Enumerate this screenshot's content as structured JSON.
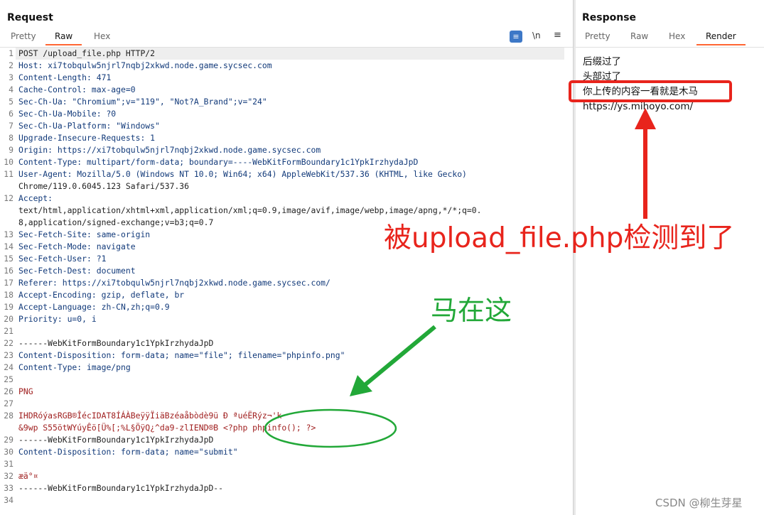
{
  "request": {
    "title": "Request",
    "tabs": [
      "Pretty",
      "Raw",
      "Hex"
    ],
    "active_tab": "Raw",
    "toolbar": {
      "wrap_icon": "≡",
      "newline_label": "\\n",
      "menu_icon": "≡"
    },
    "lines": [
      {
        "n": "1",
        "text": "POST /upload_file.php HTTP/2"
      },
      {
        "n": "2",
        "text": "Host: xi7tobqulw5njrl7nqbj2xkwd.node.game.sycsec.com"
      },
      {
        "n": "3",
        "text": "Content-Length: 471"
      },
      {
        "n": "4",
        "text": "Cache-Control: max-age=0"
      },
      {
        "n": "5",
        "text": "Sec-Ch-Ua: \"Chromium\";v=\"119\", \"Not?A_Brand\";v=\"24\""
      },
      {
        "n": "6",
        "text": "Sec-Ch-Ua-Mobile: ?0"
      },
      {
        "n": "7",
        "text": "Sec-Ch-Ua-Platform: \"Windows\""
      },
      {
        "n": "8",
        "text": "Upgrade-Insecure-Requests: 1"
      },
      {
        "n": "9",
        "text": "Origin: https://xi7tobqulw5njrl7nqbj2xkwd.node.game.sycsec.com"
      },
      {
        "n": "10",
        "text": "Content-Type: multipart/form-data; boundary=----WebKitFormBoundary1c1YpkIrzhydaJpD"
      },
      {
        "n": "11",
        "text": "User-Agent: Mozilla/5.0 (Windows NT 10.0; Win64; x64) AppleWebKit/537.36 (KHTML, like Gecko)"
      },
      {
        "n": "",
        "text": "Chrome/119.0.6045.123 Safari/537.36"
      },
      {
        "n": "12",
        "text": "Accept:"
      },
      {
        "n": "",
        "text": "text/html,application/xhtml+xml,application/xml;q=0.9,image/avif,image/webp,image/apng,*/*;q=0."
      },
      {
        "n": "",
        "text": "8,application/signed-exchange;v=b3;q=0.7"
      },
      {
        "n": "13",
        "text": "Sec-Fetch-Site: same-origin"
      },
      {
        "n": "14",
        "text": "Sec-Fetch-Mode: navigate"
      },
      {
        "n": "15",
        "text": "Sec-Fetch-User: ?1"
      },
      {
        "n": "16",
        "text": "Sec-Fetch-Dest: document"
      },
      {
        "n": "17",
        "text": "Referer: https://xi7tobqulw5njrl7nqbj2xkwd.node.game.sycsec.com/"
      },
      {
        "n": "18",
        "text": "Accept-Encoding: gzip, deflate, br"
      },
      {
        "n": "19",
        "text": "Accept-Language: zh-CN,zh;q=0.9"
      },
      {
        "n": "20",
        "text": "Priority: u=0, i"
      },
      {
        "n": "21",
        "text": ""
      },
      {
        "n": "22",
        "text": "------WebKitFormBoundary1c1YpkIrzhydaJpD"
      },
      {
        "n": "23",
        "text": "Content-Disposition: form-data; name=\"file\"; filename=\"phpinfo.png\""
      },
      {
        "n": "24",
        "text": "Content-Type: image/png"
      },
      {
        "n": "25",
        "text": ""
      },
      {
        "n": "26",
        "text": "PNG"
      },
      {
        "n": "27",
        "text": ""
      },
      {
        "n": "28",
        "text": "IHDRóýasRGB®ÎécIDAT8ÍÁÀBeÿÿÏiäBzéaåbòdè9ü Ð ªuéËRýz¬'k"
      },
      {
        "n": "",
        "text": "&9wp S55ötWYúyÊö[Ü%[;%L§ÖÿQ¿^da9-zlIEND®B <?php phpinfo(); ?>"
      },
      {
        "n": "29",
        "text": "------WebKitFormBoundary1c1YpkIrzhydaJpD"
      },
      {
        "n": "30",
        "text": "Content-Disposition: form-data; name=\"submit\""
      },
      {
        "n": "31",
        "text": ""
      },
      {
        "n": "32",
        "text": "æä°¤"
      },
      {
        "n": "33",
        "text": "------WebKitFormBoundary1c1YpkIrzhydaJpD--"
      },
      {
        "n": "34",
        "text": ""
      }
    ]
  },
  "response": {
    "title": "Response",
    "tabs": [
      "Pretty",
      "Raw",
      "Hex",
      "Render"
    ],
    "active_tab": "Render",
    "render_lines": [
      "后缀过了",
      "头部过了",
      "你上传的内容一看就是木马",
      "https://ys.mihoyo.com/"
    ]
  },
  "annotations": {
    "detected_text": "被upload_file.php检测到了",
    "horse_text": "马在这",
    "red_color": "#e8241c",
    "green_color": "#22a838"
  },
  "watermark": "CSDN @柳生芽星"
}
